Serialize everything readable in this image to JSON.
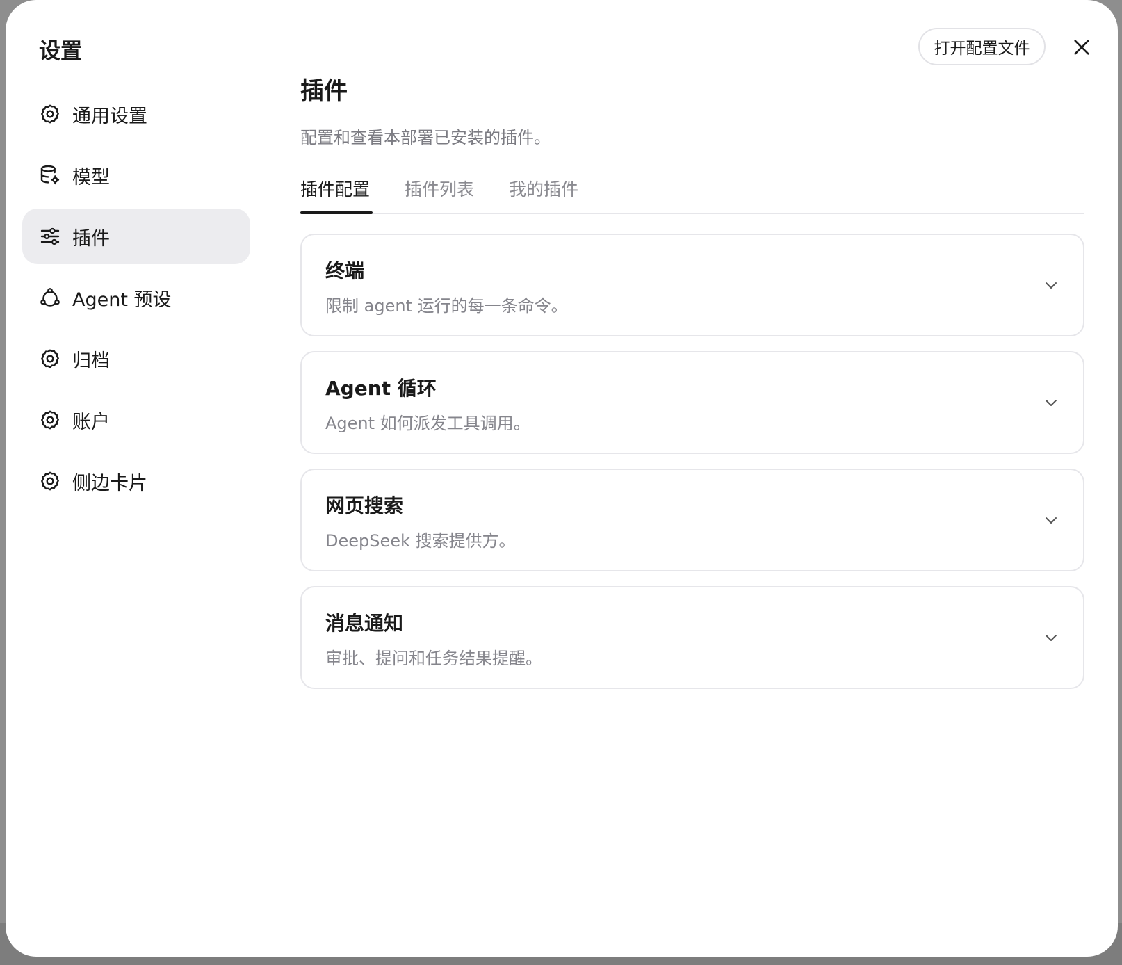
{
  "dialog": {
    "title": "设置",
    "open_config_label": "打开配置文件"
  },
  "sidebar": {
    "items": [
      {
        "label": "通用设置",
        "icon": "gear-icon",
        "active": false
      },
      {
        "label": "模型",
        "icon": "database-settings-icon",
        "active": false
      },
      {
        "label": "插件",
        "icon": "sliders-icon",
        "active": true
      },
      {
        "label": "Agent 预设",
        "icon": "workflow-icon",
        "active": false
      },
      {
        "label": "归档",
        "icon": "gear-icon",
        "active": false
      },
      {
        "label": "账户",
        "icon": "gear-icon",
        "active": false
      },
      {
        "label": "侧边卡片",
        "icon": "gear-icon",
        "active": false
      }
    ]
  },
  "main": {
    "title": "插件",
    "description": "配置和查看本部署已安装的插件。",
    "tabs": [
      {
        "label": "插件配置",
        "active": true
      },
      {
        "label": "插件列表",
        "active": false
      },
      {
        "label": "我的插件",
        "active": false
      }
    ],
    "cards": [
      {
        "title": "终端",
        "description": "限制 agent 运行的每一条命令。"
      },
      {
        "title": "Agent 循环",
        "description": "Agent 如何派发工具调用。"
      },
      {
        "title": "网页搜索",
        "description": "DeepSeek 搜索提供方。"
      },
      {
        "title": "消息通知",
        "description": "审批、提问和任务结果提醒。"
      }
    ]
  },
  "colors": {
    "active_nav_bg": "#ececef",
    "border": "#e6e6ea",
    "muted_text": "#85858c",
    "primary_text": "#1a1a1a"
  }
}
